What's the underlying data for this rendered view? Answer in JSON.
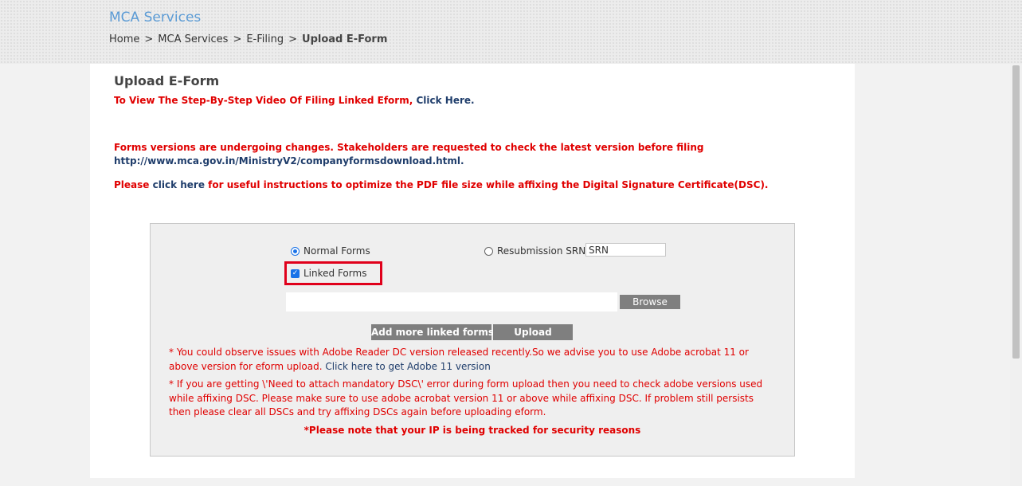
{
  "header": {
    "site_title": "MCA Services",
    "breadcrumb": [
      "Home",
      "MCA Services",
      "E-Filing",
      "Upload E-Form"
    ],
    "separator": ">"
  },
  "page": {
    "title": "Upload E-Form",
    "video_text": "To View The Step-By-Step Video Of Filing Linked Eform,",
    "video_link": "Click Here.",
    "versions_notice": "Forms versions are undergoing changes. Stakeholders are requested to check the latest version before filing",
    "versions_url": "http://www.mca.gov.in/MinistryV2/companyformsdownload.html.",
    "pdf_please": "Please",
    "pdf_link": "click here",
    "pdf_rest": "for useful instructions to optimize the PDF file size while affixing the Digital Signature Certificate(DSC)."
  },
  "form": {
    "normal_forms_label": "Normal Forms",
    "normal_forms_selected": true,
    "resubmission_label": "Resubmission SRN",
    "resubmission_selected": false,
    "srn_placeholder": "SRN",
    "linked_forms_label": "Linked Forms",
    "linked_forms_checked": true,
    "browse_label": "Browse",
    "add_more_label": "Add more linked forms",
    "upload_label": "Upload"
  },
  "notes": {
    "adobe_text": "* You could observe issues with Adobe Reader DC version released recently.So we advise you to use Adobe acrobat 11 or above version for eform upload.",
    "adobe_link": "Click here to get Adobe 11 version",
    "dsc_text": "* If you are getting \\'Need to attach mandatory DSC\\' error during form upload then you need to check adobe versions used while affixing DSC. Please make sure to use adobe acrobat version 11 or above while affixing DSC. If problem still persists then please clear all DSCs and try affixing DSCs again before uploading eform.",
    "ip_notice": "*Please note that your IP is being tracked for security reasons"
  },
  "colors": {
    "accent_red": "#e00000",
    "link_blue": "#1f3d6b",
    "title_blue": "#5b9bd5",
    "button_gray": "#7f7f7f",
    "highlight_red": "#e0001b"
  }
}
